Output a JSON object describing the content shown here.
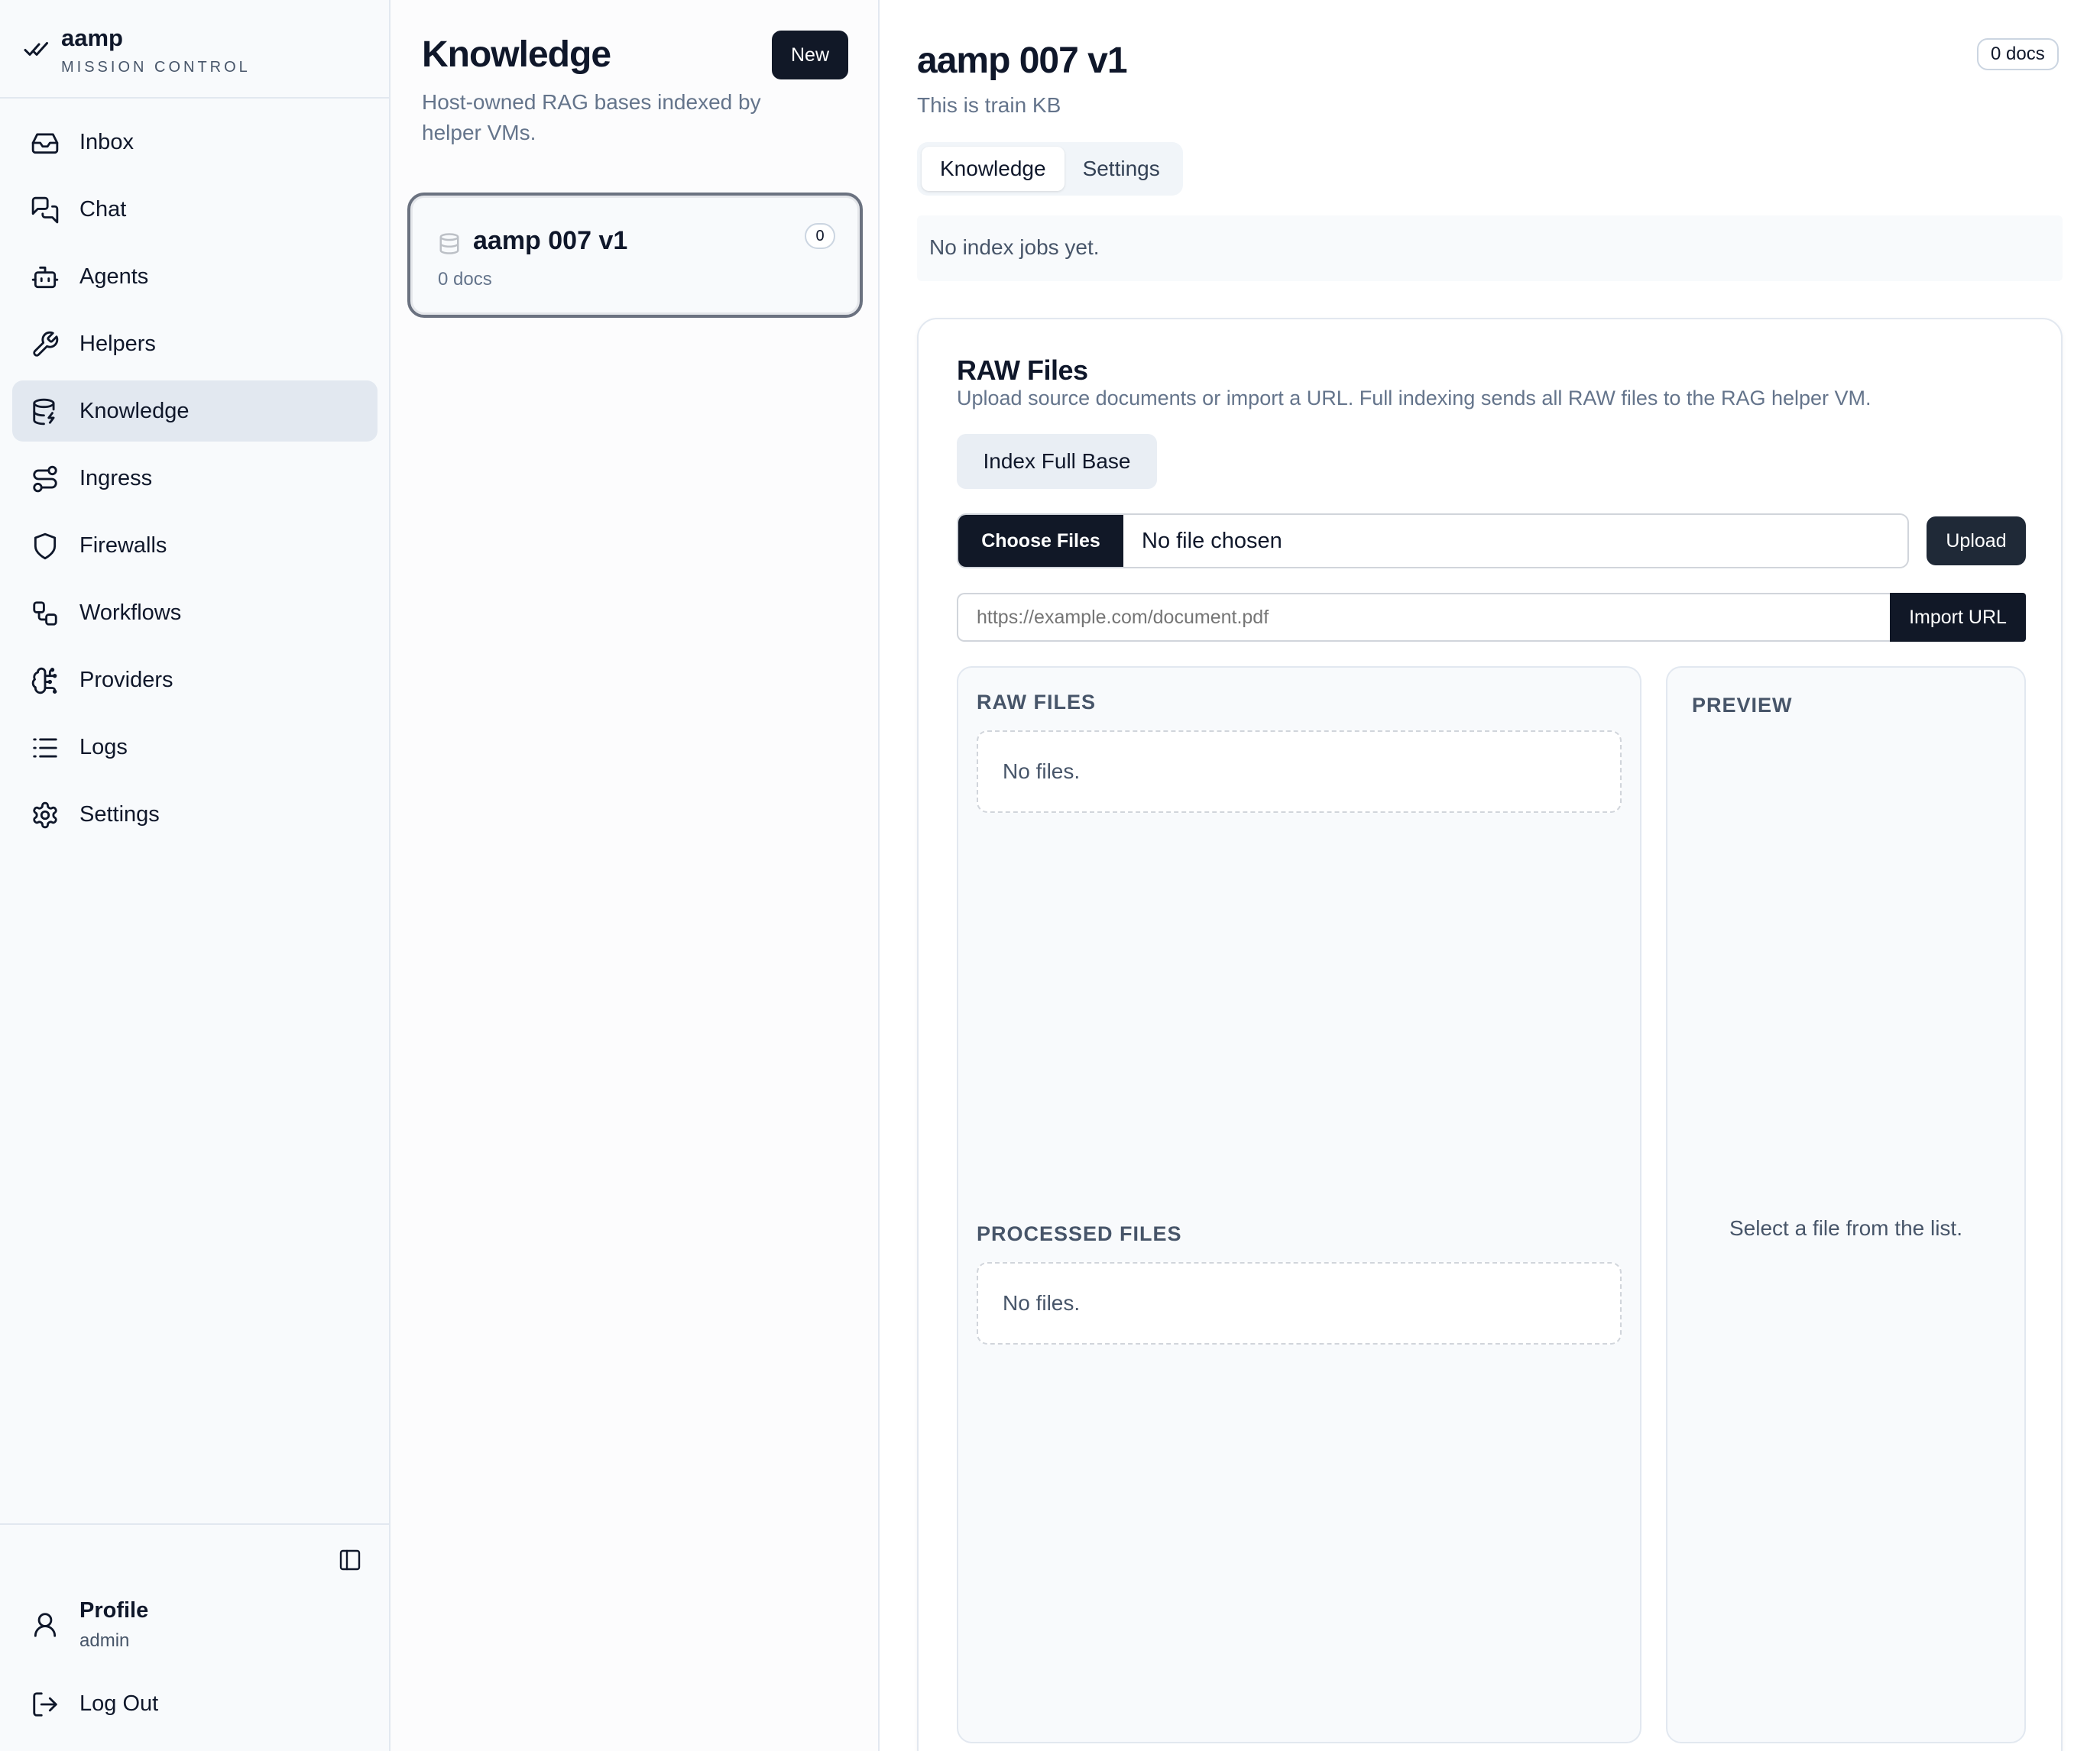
{
  "brand": {
    "name": "aamp",
    "subtitle": "MISSION CONTROL"
  },
  "sidebar": {
    "items": [
      {
        "label": "Inbox",
        "icon": "inbox-icon",
        "active": false
      },
      {
        "label": "Chat",
        "icon": "chat-icon",
        "active": false
      },
      {
        "label": "Agents",
        "icon": "bot-icon",
        "active": false
      },
      {
        "label": "Helpers",
        "icon": "wrench-icon",
        "active": false
      },
      {
        "label": "Knowledge",
        "icon": "database-icon",
        "active": true
      },
      {
        "label": "Ingress",
        "icon": "route-icon",
        "active": false
      },
      {
        "label": "Firewalls",
        "icon": "shield-icon",
        "active": false
      },
      {
        "label": "Workflows",
        "icon": "workflow-icon",
        "active": false
      },
      {
        "label": "Providers",
        "icon": "brain-icon",
        "active": false
      },
      {
        "label": "Logs",
        "icon": "list-icon",
        "active": false
      },
      {
        "label": "Settings",
        "icon": "gear-icon",
        "active": false
      }
    ],
    "profile": {
      "name": "Profile",
      "role": "admin"
    },
    "logout_label": "Log Out"
  },
  "list": {
    "title": "Knowledge",
    "subtitle": "Host-owned RAG bases indexed by helper VMs.",
    "new_label": "New",
    "items": [
      {
        "name": "aamp 007 v1",
        "docs": "0 docs",
        "count": "0"
      }
    ]
  },
  "detail": {
    "title": "aamp 007 v1",
    "subtitle": "This is train KB",
    "docs_badge": "0 docs",
    "tabs": [
      {
        "label": "Knowledge",
        "active": true
      },
      {
        "label": "Settings",
        "active": false
      }
    ],
    "jobs_empty": "No index jobs yet.",
    "raw": {
      "title": "RAW Files",
      "description": "Upload source documents or import a URL. Full indexing sends all RAW files to the RAG helper VM.",
      "index_label": "Index Full Base",
      "choose_label": "Choose Files",
      "file_status": "No file chosen",
      "upload_label": "Upload",
      "url_placeholder": "https://example.com/document.pdf",
      "import_label": "Import URL",
      "raw_files_heading": "RAW FILES",
      "raw_files_empty": "No files.",
      "processed_heading": "PROCESSED FILES",
      "processed_empty": "No files.",
      "preview_heading": "PREVIEW",
      "preview_empty": "Select a file from the list."
    }
  },
  "colors": {
    "accent_dark": "#111827",
    "active_nav_bg": "#e2e8f0",
    "muted_text": "#64748b"
  }
}
